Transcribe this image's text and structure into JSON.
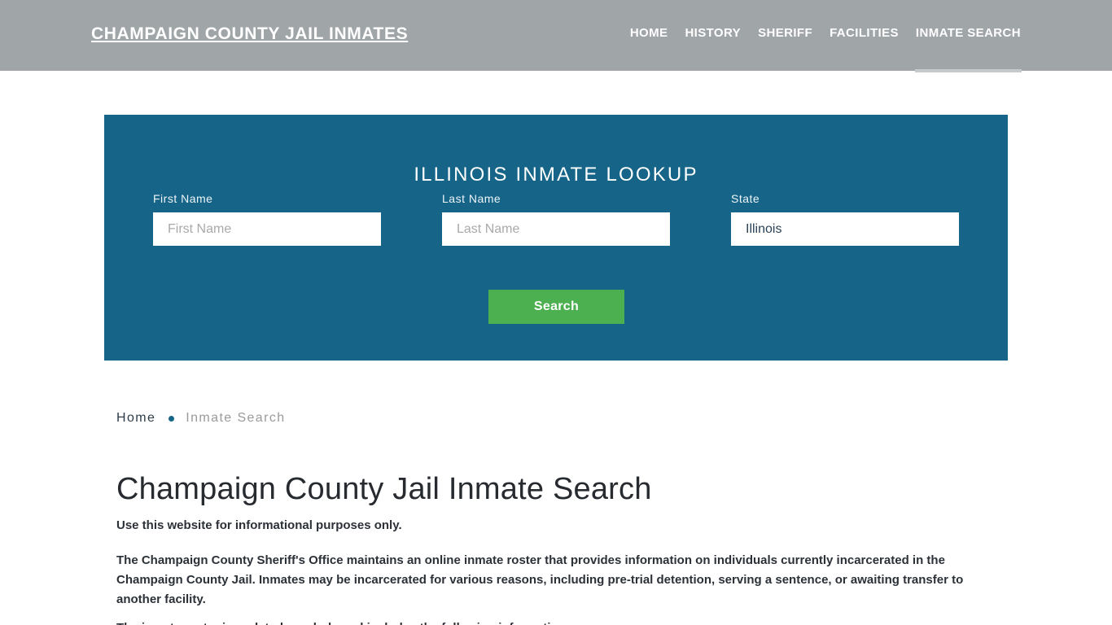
{
  "header": {
    "brand": "CHAMPAIGN COUNTY JAIL INMATES",
    "nav": [
      {
        "label": "HOME",
        "active": false
      },
      {
        "label": "HISTORY",
        "active": false
      },
      {
        "label": "SHERIFF",
        "active": false
      },
      {
        "label": "FACILITIES",
        "active": false
      },
      {
        "label": "INMATE SEARCH",
        "active": true
      }
    ],
    "background_color": "#a0a5a8",
    "text_color": "#ffffff",
    "active_underline_color": "#c5c9cb"
  },
  "search_panel": {
    "title": "ILLINOIS INMATE LOOKUP",
    "background_color": "#166588",
    "fields": {
      "first_name": {
        "label": "First Name",
        "placeholder": "First Name",
        "value": ""
      },
      "last_name": {
        "label": "Last Name",
        "placeholder": "Last Name",
        "value": ""
      },
      "state": {
        "label": "State",
        "value": "Illinois",
        "options": [
          "Illinois"
        ]
      }
    },
    "submit": {
      "label": "Search",
      "color": "#4cb050"
    }
  },
  "breadcrumb": {
    "home": "Home",
    "separator": "•",
    "current": "Inmate Search",
    "bullet_color": "#166588"
  },
  "main": {
    "title": "Champaign County Jail Inmate Search",
    "lead_note": "Use this website for informational purposes only.",
    "paragraph_1": "The Champaign County Sheriff's Office maintains an online inmate roster that provides information on individuals currently incarcerated in the Champaign County Jail. Inmates may be incarcerated for various reasons, including pre-trial detention, serving a sentence, or awaiting transfer to another facility.",
    "paragraph_2": "The inmate roster is updated regularly and includes the following information:"
  }
}
